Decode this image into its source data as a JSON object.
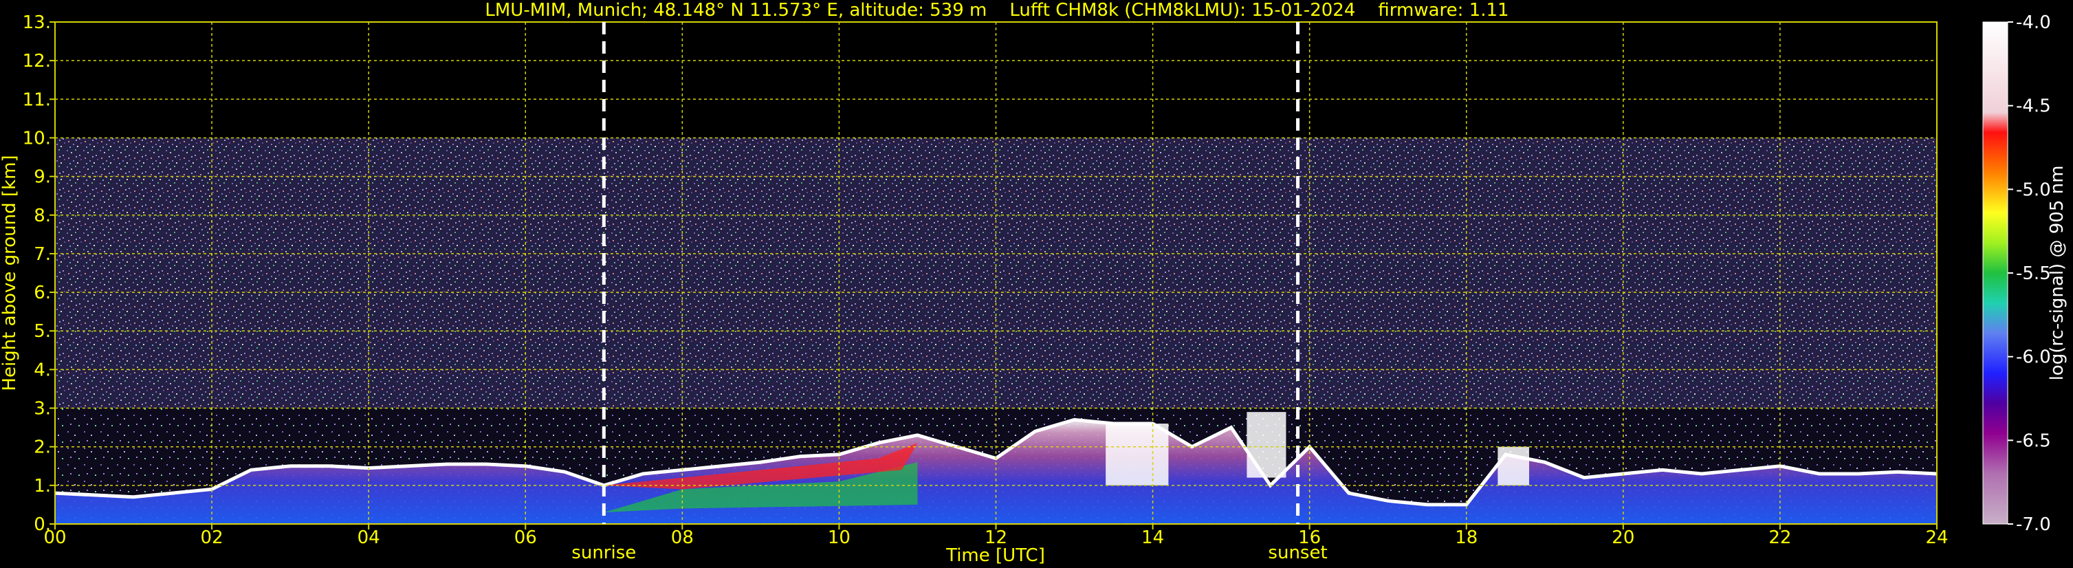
{
  "chart_data": {
    "type": "heatmap",
    "title": "LMU-MIM, Munich; 48.148° N 11.573° E, altitude: 539 m    Lufft CHM8k (CHM8kLMU): 15-01-2024    firmware: 1.11",
    "xlabel": "Time [UTC]",
    "ylabel": "Height above ground [km]",
    "xlim": [
      0,
      24
    ],
    "ylim": [
      0,
      13
    ],
    "x_ticks": [
      "00",
      "02",
      "04",
      "06",
      "08",
      "10",
      "12",
      "14",
      "16",
      "18",
      "20",
      "22",
      "24"
    ],
    "y_ticks": [
      "0.",
      "1.",
      "2.",
      "3.",
      "4.",
      "5.",
      "6.",
      "7.",
      "8.",
      "9.",
      "10.",
      "11.",
      "12.",
      "13."
    ],
    "grid": true,
    "annotations": [
      {
        "label": "sunrise",
        "time": 7.0
      },
      {
        "label": "sunset",
        "time": 15.85
      }
    ],
    "colorbar": {
      "label": "log(rc-signal) @ 905 nm",
      "range": [
        -7.0,
        -4.0
      ],
      "ticks": [
        "-4.0",
        "-4.5",
        "-5.0",
        "-5.5",
        "-6.0",
        "-6.5",
        "-7.0"
      ]
    },
    "data_top_km": 10.0,
    "series": [
      {
        "name": "boundary_layer_top",
        "x": [
          0,
          0.5,
          1,
          1.5,
          2,
          2.5,
          3,
          3.5,
          4,
          4.5,
          5,
          5.5,
          6,
          6.5,
          7,
          7.5,
          8,
          8.5,
          9,
          9.5,
          10,
          10.5,
          11,
          11.5,
          12,
          12.5,
          13,
          13.5,
          14,
          14.5,
          15,
          15.5,
          16,
          16.5,
          17,
          17.5,
          18,
          18.5,
          19,
          19.5,
          20,
          20.5,
          21,
          21.5,
          22,
          22.5,
          23,
          23.5,
          24
        ],
        "y": [
          0.8,
          0.75,
          0.7,
          0.8,
          0.9,
          1.4,
          1.5,
          1.5,
          1.45,
          1.5,
          1.55,
          1.55,
          1.5,
          1.35,
          1.0,
          1.3,
          1.4,
          1.5,
          1.6,
          1.75,
          1.8,
          2.1,
          2.3,
          2.0,
          1.7,
          2.4,
          2.7,
          2.6,
          2.6,
          2.0,
          2.5,
          1.0,
          2.0,
          0.8,
          0.6,
          0.5,
          0.5,
          1.8,
          1.6,
          1.2,
          1.3,
          1.4,
          1.3,
          1.4,
          1.5,
          1.3,
          1.3,
          1.35,
          1.3
        ]
      }
    ]
  }
}
